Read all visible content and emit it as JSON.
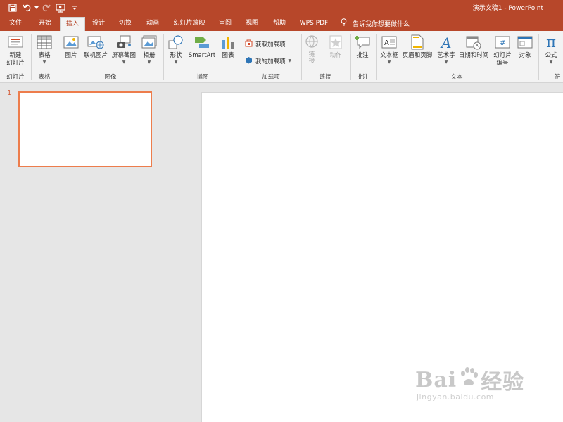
{
  "window": {
    "title": "演示文稿1 - PowerPoint"
  },
  "quick_access": [
    {
      "name": "save-icon"
    },
    {
      "name": "undo-icon"
    },
    {
      "name": "undo-dropdown-icon"
    },
    {
      "name": "redo-icon"
    },
    {
      "name": "start-from-beginning-icon"
    },
    {
      "name": "customize-qat-icon"
    }
  ],
  "tabs": [
    "文件",
    "开始",
    "插入",
    "设计",
    "切换",
    "动画",
    "幻灯片放映",
    "审阅",
    "视图",
    "帮助",
    "WPS PDF"
  ],
  "active_tab": "插入",
  "tell_me": {
    "text": "告诉我你想要做什么",
    "icon": "lightbulb-icon"
  },
  "ribbon": {
    "slides": {
      "label": "幻灯片",
      "new_slide": "新建\n幻灯片"
    },
    "tables": {
      "label": "表格",
      "table": "表格"
    },
    "images": {
      "label": "图像",
      "picture": "图片",
      "online_picture": "联机图片",
      "screenshot": "屏幕截图",
      "album": "相册"
    },
    "illustrations": {
      "label": "插图",
      "shapes": "形状",
      "smartart": "SmartArt",
      "chart": "图表"
    },
    "addins": {
      "label": "加载项",
      "get_addins": "获取加载项",
      "my_addins": "我的加载项"
    },
    "links": {
      "label": "链接",
      "link": "链\n接",
      "action": "动作"
    },
    "comments": {
      "label": "批注",
      "comment": "批注"
    },
    "text": {
      "label": "文本",
      "textbox": "文本框",
      "header_footer": "页眉和页脚",
      "wordart": "艺术字",
      "datetime": "日期和时间",
      "slide_number": "幻灯片\n编号",
      "object": "对象"
    },
    "symbols": {
      "label": "符",
      "equation": "公式"
    }
  },
  "colors": {
    "accent": "#b7472a",
    "selection": "#ed7d4c"
  },
  "slides": [
    {
      "number": "1"
    }
  ],
  "watermark": {
    "brand_start": "Bai",
    "brand_end": "经验",
    "url": "jingyan.baidu.com"
  }
}
